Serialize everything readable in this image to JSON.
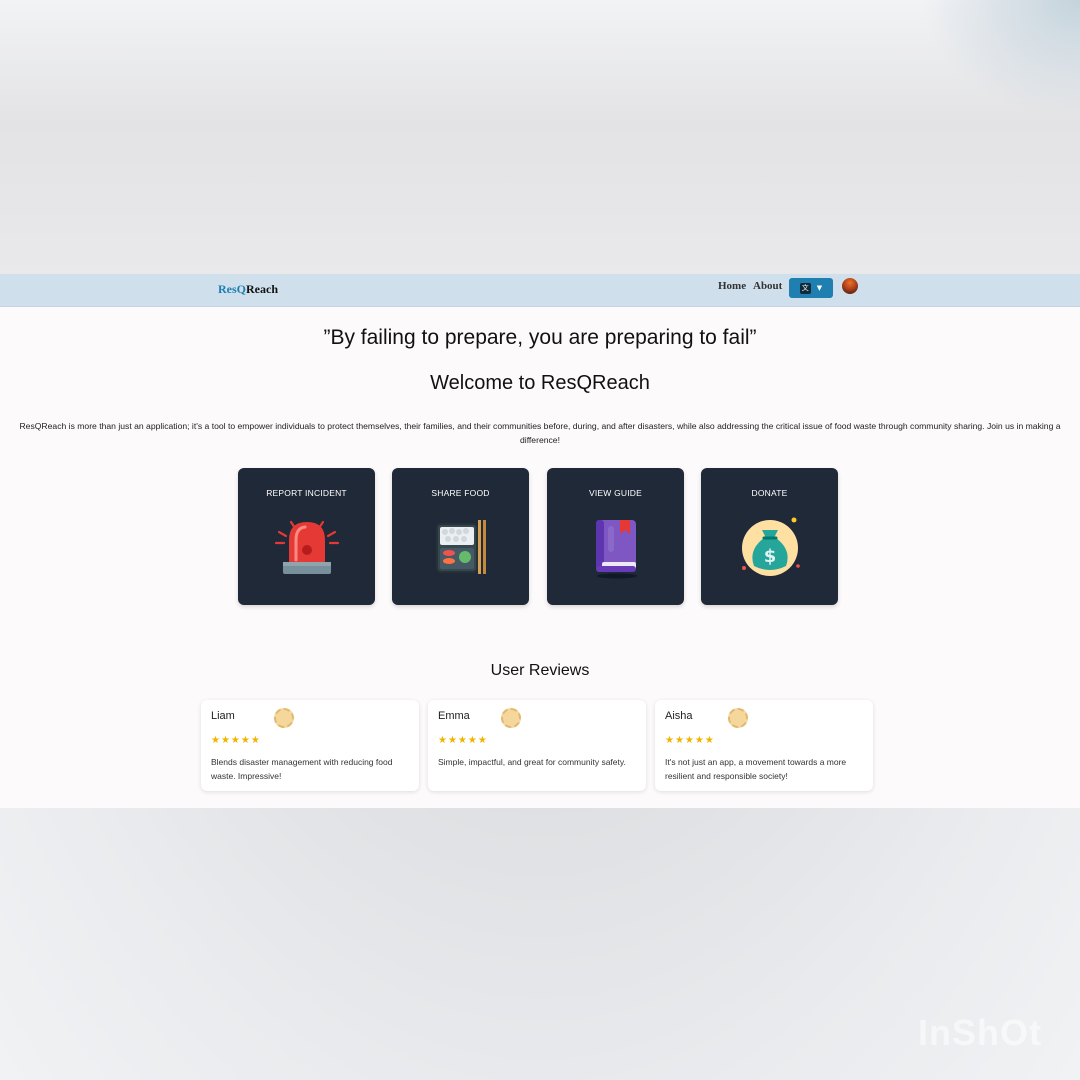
{
  "navbar": {
    "brand_part1": "ResQ",
    "brand_part2": "Reach",
    "links": [
      "Home",
      "About"
    ],
    "language_icon": "translate-icon",
    "chevron_icon": "chevron-down-icon"
  },
  "hero": {
    "quote": "”By failing to prepare, you are preparing to fail”",
    "welcome": "Welcome to ResQReach",
    "intro": "ResQReach is more than just an application; it's a tool to empower individuals to protect themselves, their families, and their communities before, during, and after disasters, while also addressing the critical issue of food waste through community sharing. Join us in making a difference!"
  },
  "actions": [
    {
      "title": "REPORT INCIDENT",
      "icon": "siren-icon"
    },
    {
      "title": "SHARE FOOD",
      "icon": "bento-box-icon"
    },
    {
      "title": "VIEW GUIDE",
      "icon": "book-icon"
    },
    {
      "title": "DONATE",
      "icon": "money-bag-icon"
    }
  ],
  "reviews": {
    "title": "User Reviews",
    "items": [
      {
        "name": "Liam",
        "stars": "★★★★★",
        "rating": 5,
        "text": "Blends disaster management with reducing food waste. Impressive!"
      },
      {
        "name": "Emma",
        "stars": "★★★★★",
        "rating": 5,
        "text": "Simple, impactful, and great for community safety."
      },
      {
        "name": "Aisha",
        "stars": "★★★★★",
        "rating": 5,
        "text": "It's not just an app, a movement towards a more resilient and responsible society!"
      }
    ]
  },
  "colors": {
    "navbar_bg": "#cfe0ec",
    "brand_accent": "#1e7fb0",
    "card_bg": "#1f2937",
    "star": "#f0b400"
  },
  "watermark": "InShOt"
}
